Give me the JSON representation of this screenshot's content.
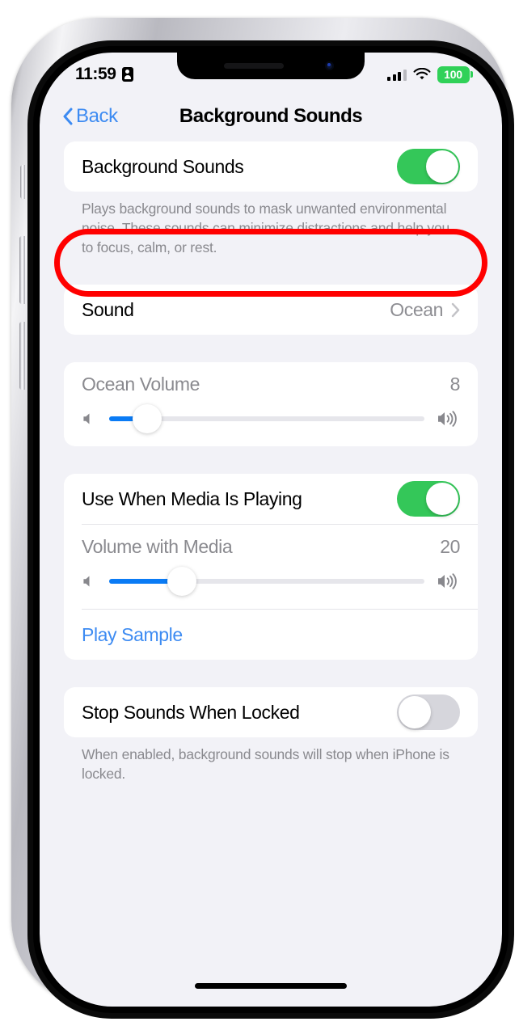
{
  "status_bar": {
    "time": "11:59",
    "focus_icon": "person-badge-icon",
    "cellular_icon": "cellular-bars-icon",
    "wifi_icon": "wifi-icon",
    "battery_percent": "100"
  },
  "nav": {
    "back_icon": "chevron-left-icon",
    "back_label": "Back",
    "title": "Background Sounds"
  },
  "sections": {
    "main_toggle": {
      "label": "Background Sounds",
      "toggle_state": "on",
      "footnote": "Plays background sounds to mask unwanted environmental noise. These sounds can minimize distractions and help you to focus, calm, or rest."
    },
    "sound": {
      "label": "Sound",
      "value": "Ocean",
      "chevron_icon": "chevron-right-icon"
    },
    "ocean_volume": {
      "label": "Ocean Volume",
      "value": "8",
      "fill_percent": 12,
      "min_icon": "speaker-low-icon",
      "max_icon": "speaker-high-icon"
    },
    "media": {
      "label": "Use When Media Is Playing",
      "toggle_state": "on",
      "volume_label": "Volume with Media",
      "volume_value": "20",
      "fill_percent": 23,
      "min_icon": "speaker-low-icon",
      "max_icon": "speaker-high-icon",
      "play_sample_label": "Play Sample"
    },
    "locked": {
      "label": "Stop Sounds When Locked",
      "toggle_state": "off",
      "footnote": "When enabled, background sounds will stop when iPhone is locked."
    }
  },
  "annotation": {
    "highlight_color": "#ff0000",
    "target": "Background Sounds"
  },
  "theme": {
    "page_background": "#f2f2f7",
    "card_background": "#ffffff",
    "accent_blue": "#3d8bf2",
    "slider_blue": "#0a7bf5",
    "toggle_on_green": "#34c759",
    "toggle_off_gray": "#d6d6dc",
    "battery_green": "#30d158",
    "secondary_text": "#8a8a8f"
  }
}
